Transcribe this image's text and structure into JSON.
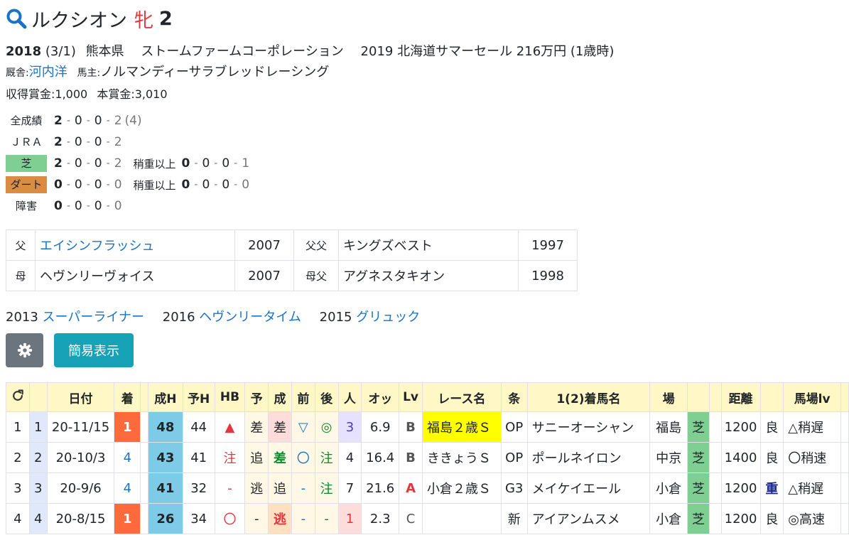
{
  "horse": {
    "name": "ルクシオン",
    "sex": "牝",
    "age": "2"
  },
  "profile": {
    "birth_year": "2018",
    "birth_date": "(3/1)",
    "region": "熊本県",
    "breeder": "ストームファームコーポレーション",
    "sale": "2019 北海道サマーセール 216万円 (1歳時)",
    "trainer_label": "厩舎:",
    "trainer": "河内洋",
    "owner_label": "馬主:",
    "owner": "ノルマンディーサラブレッドレーシング",
    "earnings_label": "収得賞金:",
    "earnings": "1,000",
    "prize_label": "本賞金:",
    "prize": "3,010"
  },
  "records": [
    {
      "label": "全成績",
      "vals": [
        "2",
        "0",
        "0",
        "2"
      ],
      "extra": "(4)"
    },
    {
      "label": "ＪＲＡ",
      "vals": [
        "2",
        "0",
        "0",
        "2"
      ]
    },
    {
      "label": "芝",
      "vals": [
        "2",
        "0",
        "0",
        "2"
      ],
      "sub_label": "稍重以上",
      "sub_vals": [
        "0",
        "0",
        "0",
        "1"
      ]
    },
    {
      "label": "ダート",
      "vals": [
        "0",
        "0",
        "0",
        "0"
      ],
      "sub_label": "稍重以上",
      "sub_vals": [
        "0",
        "0",
        "0",
        "0"
      ]
    },
    {
      "label": "障害",
      "vals": [
        "0",
        "0",
        "0",
        "0"
      ]
    }
  ],
  "pedigree": {
    "sire_label": "父",
    "sire": "エイシンフラッシュ",
    "sire_year": "2007",
    "sires_sire_label": "父父",
    "sires_sire": "キングズベスト",
    "sires_sire_year": "1997",
    "dam_label": "母",
    "dam": "ヘヴンリーヴォイス",
    "dam_year": "2007",
    "dams_sire_label": "母父",
    "dams_sire": "アグネスタキオン",
    "dams_sire_year": "1998"
  },
  "siblings": [
    {
      "year": "2013",
      "name": "スーパーライナー"
    },
    {
      "year": "2016",
      "name": "ヘヴンリータイム"
    },
    {
      "year": "2015",
      "name": "グリュック"
    }
  ],
  "buttons": {
    "simple": "簡易表示"
  },
  "table": {
    "headers": [
      "",
      "",
      "日付",
      "着",
      "",
      "成H",
      "予H",
      "HB",
      "予",
      "成",
      "前",
      "後",
      "人",
      "オッ",
      "Lv",
      "レース名",
      "条",
      "1(2)着馬名",
      "場",
      "",
      "距離",
      "",
      "馬場lv",
      ""
    ],
    "rows": [
      {
        "n": "1",
        "i": "1",
        "date": "20-11/15",
        "rank": "1",
        "h": "48",
        "yh": "44",
        "hb": "▲",
        "yo": "差",
        "sei": "差",
        "mae": "▽",
        "ato": "◎",
        "pop": "3",
        "odds": "6.9",
        "lv": "B",
        "race": "福島２歳Ｓ",
        "cls": "OP",
        "winner": "サニーオーシャン",
        "place": "福島",
        "surf": "芝",
        "dist": "1200",
        "cond": "良",
        "blv": "△稍遅"
      },
      {
        "n": "2",
        "i": "2",
        "date": "20-10/3",
        "rank": "4",
        "h": "43",
        "yh": "41",
        "hb": "注",
        "yo": "追",
        "sei": "差",
        "mae": "〇",
        "ato": "注",
        "pop": "4",
        "odds": "16.4",
        "lv": "B",
        "race": "ききょうＳ",
        "cls": "OP",
        "winner": "ポールネイロン",
        "place": "中京",
        "surf": "芝",
        "dist": "1400",
        "cond": "良",
        "blv": "〇稍速"
      },
      {
        "n": "3",
        "i": "3",
        "date": "20-9/6",
        "rank": "4",
        "h": "41",
        "yh": "32",
        "hb": "-",
        "yo": "逃",
        "sei": "追",
        "mae": "-",
        "ato": "注",
        "pop": "7",
        "odds": "21.6",
        "lv": "A",
        "race": "小倉２歳Ｓ",
        "cls": "G3",
        "winner": "メイケイエール",
        "place": "小倉",
        "surf": "芝",
        "dist": "1200",
        "cond": "重",
        "blv": "△稍遅"
      },
      {
        "n": "4",
        "i": "4",
        "date": "20-8/15",
        "rank": "1",
        "h": "26",
        "yh": "34",
        "hb": "〇",
        "yo": "-",
        "sei": "逃",
        "mae": "-",
        "ato": "-",
        "pop": "1",
        "odds": "2.3",
        "lv": "C",
        "race": "",
        "cls": "新",
        "winner": "アイアンムスメ",
        "place": "小倉",
        "surf": "芝",
        "dist": "1200",
        "cond": "良",
        "blv": "◎高速"
      }
    ]
  }
}
